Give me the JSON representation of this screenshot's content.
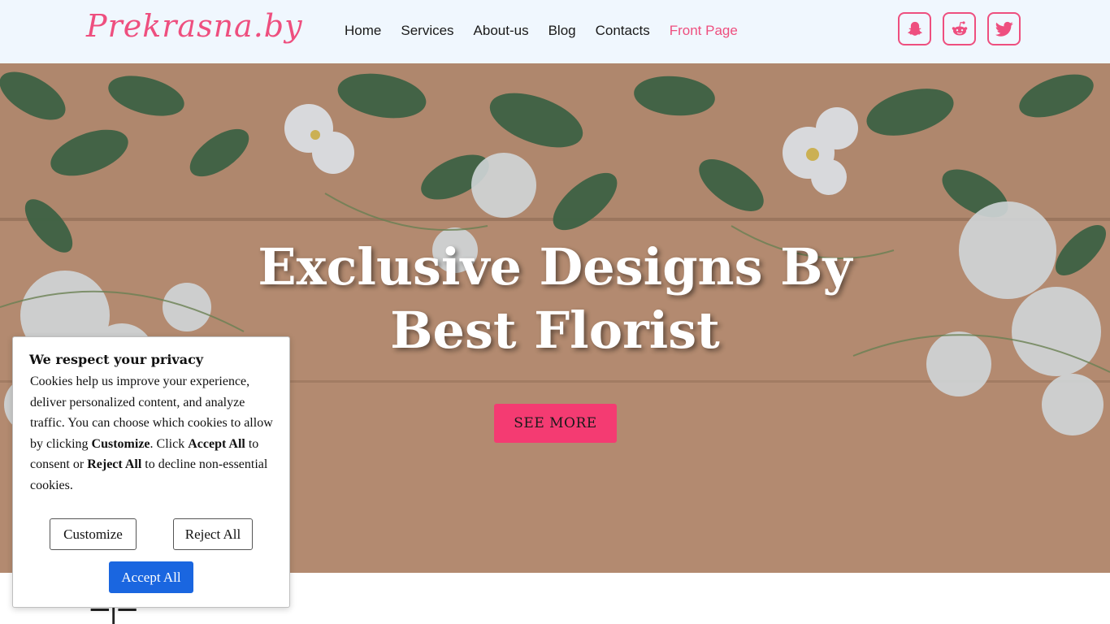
{
  "header": {
    "logo": "Prekrasna.by",
    "nav": [
      {
        "label": "Home"
      },
      {
        "label": "Services"
      },
      {
        "label": "About-us"
      },
      {
        "label": "Blog"
      },
      {
        "label": "Contacts"
      },
      {
        "label": "Front Page",
        "active": true
      }
    ],
    "social_icons": [
      "snapchat-icon",
      "reddit-icon",
      "twitter-icon"
    ]
  },
  "hero": {
    "title_line1": "Exclusive Designs By",
    "title_line2": "Best Florist",
    "cta_label": "SEE MORE"
  },
  "below": {
    "partial_text": "═|═"
  },
  "cookie": {
    "title": "We respect your privacy",
    "body_part1": "Cookies help us improve your experience, deliver personalized content, and analyze traffic. You can choose which cookies to allow by clicking ",
    "body_bold1": "Customize",
    "body_part2": ". Click ",
    "body_bold2": "Accept All",
    "body_part3": " to consent or ",
    "body_bold3": "Reject All",
    "body_part4": " to decline non-essential cookies.",
    "customize_label": "Customize",
    "reject_label": "Reject All",
    "accept_label": "Accept All"
  },
  "colors": {
    "accent": "#ee4f7f",
    "cta": "#f43b72",
    "header_bg": "#f0f7fe",
    "accept_bg": "#1a66e0"
  }
}
